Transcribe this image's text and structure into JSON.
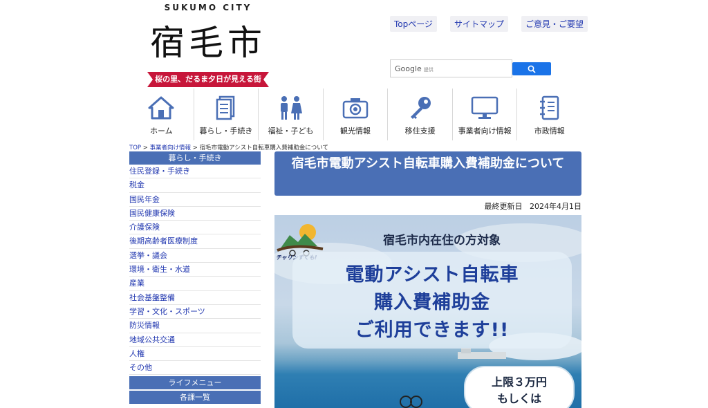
{
  "logo": {
    "sub": "SUKUMO CITY",
    "main": "宿毛市",
    "tagline": "桜の里、だるま夕日が見える街"
  },
  "top_links": [
    "Topページ",
    "サイトマップ",
    "ご意見・ご要望"
  ],
  "search": {
    "brand": "Google",
    "brand_sub": "提供",
    "placeholder": ""
  },
  "nav": [
    {
      "label": "ホーム",
      "icon": "home-icon"
    },
    {
      "label": "暮らし・手続き",
      "icon": "document-icon"
    },
    {
      "label": "福祉・子ども",
      "icon": "family-icon"
    },
    {
      "label": "観光情報",
      "icon": "camera-icon"
    },
    {
      "label": "移住支援",
      "icon": "key-icon"
    },
    {
      "label": "事業者向け情報",
      "icon": "monitor-icon"
    },
    {
      "label": "市政情報",
      "icon": "notebook-icon"
    }
  ],
  "breadcrumb": {
    "items": [
      "TOP",
      "事業者向け情報"
    ],
    "separator": ">",
    "current": "宿毛市電動アシスト自転車購入費補助金について"
  },
  "sidebar": {
    "heading": "暮らし・手続き",
    "items": [
      "住民登録・手続き",
      "税金",
      "国民年金",
      "国民健康保険",
      "介護保険",
      "後期高齢者医療制度",
      "選挙・議会",
      "環境・衛生・水道",
      "産業",
      "社会基盤整備",
      "学習・文化・スポーツ",
      "防災情報",
      "地域公共交通",
      "人権",
      "その他"
    ],
    "footer1": "ライフメニュー",
    "footer2": "各課一覧"
  },
  "main": {
    "title": "宿毛市電動アシスト自転車購入費補助金について",
    "updated_label": "最終更新日",
    "updated_date": "2024年4月1日"
  },
  "flyer": {
    "mascot": "チャリンすくも!",
    "top_text": "宿毛市内在住の方対象",
    "line1": "電動アシスト自転車",
    "line2": "購入費補助金",
    "line3": "ご利用できます!!",
    "badge1": "上限３万円",
    "badge2": "もしくは"
  },
  "colors": {
    "accent": "#4a6fb5",
    "link": "#2238b0",
    "ribbon": "#c7163a",
    "icon": "#4a6fb5"
  }
}
